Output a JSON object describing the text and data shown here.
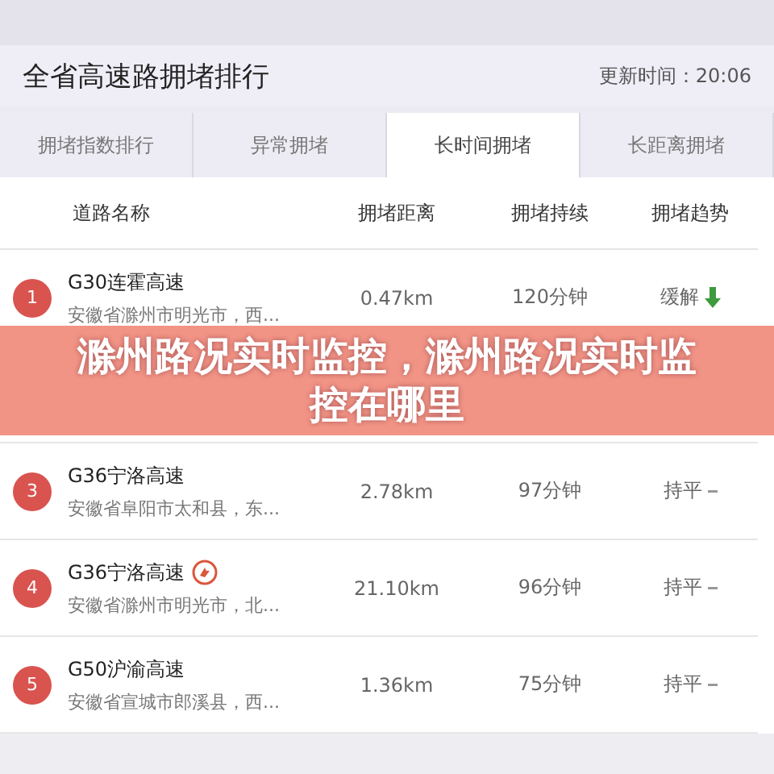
{
  "header": {
    "title": "全省高速路拥堵排行",
    "update_label": "更新时间：",
    "update_time": "20:06"
  },
  "tabs": [
    {
      "label": "拥堵指数排行",
      "selected": false
    },
    {
      "label": "异常拥堵",
      "selected": false
    },
    {
      "label": "长时间拥堵",
      "selected": true
    },
    {
      "label": "长距离拥堵",
      "selected": false
    }
  ],
  "columns": [
    "道路名称",
    "拥堵距离",
    "拥堵持续",
    "拥堵趋势"
  ],
  "rows": [
    {
      "rank": "1",
      "name": "G30连霍高速",
      "address": "安徽省滁州市明光市，西...",
      "distance": "0.47km",
      "duration": "120分钟",
      "trend_label": "缓解",
      "kind": "down"
    },
    {
      "hidden": true
    },
    {
      "rank": "3",
      "name": "G36宁洛高速",
      "address": "安徽省阜阳市太和县，东...",
      "distance": "2.78km",
      "duration": "97分钟",
      "trend_label": "持平",
      "kind": "flat"
    },
    {
      "rank": "4",
      "name": "G36宁洛高速",
      "address": "安徽省滁州市明光市，北...",
      "distance": "21.10km",
      "duration": "96分钟",
      "trend_label": "持平",
      "kind": "flat",
      "badge": true
    },
    {
      "rank": "5",
      "name": "G50沪渝高速",
      "address": "安徽省宣城市郎溪县，西...",
      "distance": "1.36km",
      "duration": "75分钟",
      "trend_label": "持平",
      "kind": "flat"
    }
  ],
  "banner": {
    "text": "滁州路况实时监控，滁州路况实时监控在哪里"
  }
}
